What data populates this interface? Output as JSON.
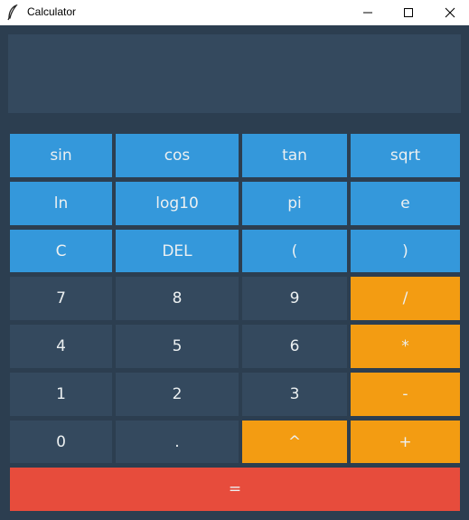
{
  "window": {
    "title": "Calculator",
    "icon": "feather-icon"
  },
  "display": {
    "value": ""
  },
  "colors": {
    "background": "#2c3e50",
    "display": "#34495e",
    "function_key": "#3498db",
    "number_key": "#34495e",
    "operator_key": "#f39c12",
    "equals_key": "#e74c3c",
    "key_text": "#ecf0f1"
  },
  "keys": {
    "sin": "sin",
    "cos": "cos",
    "tan": "tan",
    "sqrt": "sqrt",
    "ln": "ln",
    "log10": "log10",
    "pi": "pi",
    "e": "e",
    "clear": "C",
    "delete": "DEL",
    "lparen": "(",
    "rparen": ")",
    "seven": "7",
    "eight": "8",
    "nine": "9",
    "divide": "/",
    "four": "4",
    "five": "5",
    "six": "6",
    "multiply": "*",
    "one": "1",
    "two": "2",
    "three": "3",
    "minus": "-",
    "zero": "0",
    "dot": ".",
    "power": "^",
    "plus": "+",
    "equals": "="
  }
}
